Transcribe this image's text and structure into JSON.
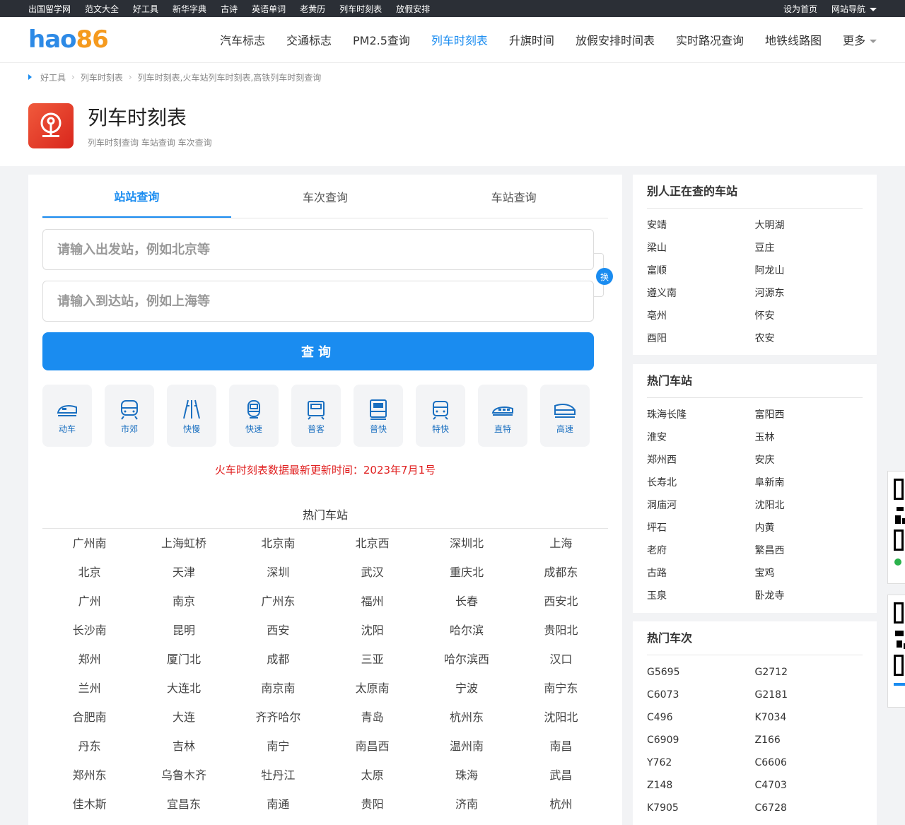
{
  "topbar": {
    "links": [
      "出国留学网",
      "范文大全",
      "好工具",
      "新华字典",
      "古诗",
      "英语单词",
      "老黄历",
      "列车时刻表",
      "放假安排"
    ],
    "set_home": "设为首页",
    "site_nav": "网站导航"
  },
  "header": {
    "logo_part1": "hao",
    "logo_part2": "86",
    "nav": [
      "汽车标志",
      "交通标志",
      "PM2.5查询",
      "列车时刻表",
      "升旗时间",
      "放假安排时间表",
      "实时路况查询",
      "地铁线路图"
    ],
    "active_index": 3,
    "more": "更多"
  },
  "breadcrumb": [
    "好工具",
    "列车时刻表",
    "列车时刻表,火车站列车时刻表,高铁列车时刻查询"
  ],
  "page": {
    "title": "列车时刻表",
    "subtitle": "列车时刻查询 车站查询 车次查询"
  },
  "tabs": [
    "站站查询",
    "车次查询",
    "车站查询"
  ],
  "form": {
    "from_placeholder": "请输入出发站，例如北京等",
    "to_placeholder": "请输入到达站，例如上海等",
    "swap_label": "换",
    "search_label": "查询"
  },
  "train_types": [
    {
      "label": "动车",
      "icon": "bullet-train-icon"
    },
    {
      "label": "市郊",
      "icon": "suburban-train-icon"
    },
    {
      "label": "快慢",
      "icon": "track-icon"
    },
    {
      "label": "快速",
      "icon": "fast-train-icon"
    },
    {
      "label": "普客",
      "icon": "passenger-train-icon"
    },
    {
      "label": "普快",
      "icon": "express-train-icon"
    },
    {
      "label": "特快",
      "icon": "special-express-icon"
    },
    {
      "label": "直特",
      "icon": "direct-train-icon"
    },
    {
      "label": "高速",
      "icon": "high-speed-icon"
    }
  ],
  "update_text": "火车时刻表数据最新更新时间：2023年7月1号",
  "hot_stations": {
    "title": "热门车站",
    "items": [
      "广州南",
      "上海虹桥",
      "北京南",
      "北京西",
      "深圳北",
      "上海",
      "北京",
      "天津",
      "深圳",
      "武汉",
      "重庆北",
      "成都东",
      "广州",
      "南京",
      "广州东",
      "福州",
      "长春",
      "西安北",
      "长沙南",
      "昆明",
      "西安",
      "沈阳",
      "哈尔滨",
      "贵阳北",
      "郑州",
      "厦门北",
      "成都",
      "三亚",
      "哈尔滨西",
      "汉口",
      "兰州",
      "大连北",
      "南京南",
      "太原南",
      "宁波",
      "南宁东",
      "合肥南",
      "大连",
      "齐齐哈尔",
      "青岛",
      "杭州东",
      "沈阳北",
      "丹东",
      "吉林",
      "南宁",
      "南昌西",
      "温州南",
      "南昌",
      "郑州东",
      "乌鲁木齐",
      "牡丹江",
      "太原",
      "珠海",
      "武昌",
      "佳木斯",
      "宜昌东",
      "南通",
      "贵阳",
      "济南",
      "杭州"
    ]
  },
  "sidebar": {
    "recent": {
      "title": "别人正在查的车站",
      "items": [
        "安靖",
        "大明湖",
        "梁山",
        "豆庄",
        "富顺",
        "阿龙山",
        "遵义南",
        "河源东",
        "亳州",
        "怀安",
        "酉阳",
        "农安"
      ]
    },
    "hot_stations": {
      "title": "热门车站",
      "items": [
        "珠海长隆",
        "富阳西",
        "淮安",
        "玉林",
        "郑州西",
        "安庆",
        "长寿北",
        "阜新南",
        "洞庙河",
        "沈阳北",
        "坪石",
        "内黄",
        "老府",
        "繁昌西",
        "古路",
        "宝鸡",
        "玉泉",
        "卧龙寺"
      ]
    },
    "hot_trains": {
      "title": "热门车次",
      "items": [
        "G5695",
        "G2712",
        "C6073",
        "G2181",
        "C496",
        "K7034",
        "C6909",
        "Z166",
        "Y762",
        "C6606",
        "Z148",
        "C4703",
        "K7905",
        "C6728"
      ]
    }
  },
  "colors": {
    "accent": "#1a8cf0",
    "topbar": "#2b2f36",
    "alert": "#e02020"
  }
}
